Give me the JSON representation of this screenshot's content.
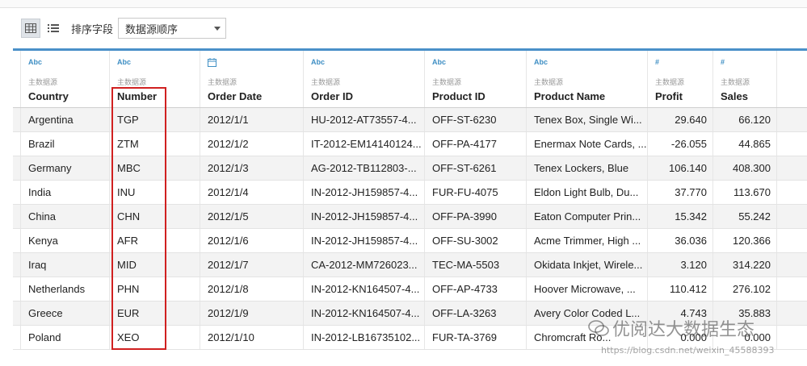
{
  "toolbar": {
    "sort_label": "排序字段",
    "sort_value": "数据源顺序"
  },
  "columns": [
    {
      "type": "Abc",
      "source": "主数据源",
      "name": "Country"
    },
    {
      "type": "Abc",
      "source": "主数据源",
      "name": "Number"
    },
    {
      "type": "date",
      "source": "主数据源",
      "name": "Order Date"
    },
    {
      "type": "Abc",
      "source": "主数据源",
      "name": "Order ID"
    },
    {
      "type": "Abc",
      "source": "主数据源",
      "name": "Product ID"
    },
    {
      "type": "Abc",
      "source": "主数据源",
      "name": "Product Name"
    },
    {
      "type": "#",
      "source": "主数据源",
      "name": "Profit"
    },
    {
      "type": "#",
      "source": "主数据源",
      "name": "Sales"
    }
  ],
  "rows": [
    [
      "Argentina",
      "TGP",
      "2012/1/1",
      "HU-2012-AT73557-4...",
      "OFF-ST-6230",
      "Tenex Box, Single Wi...",
      "29.640",
      "66.120"
    ],
    [
      "Brazil",
      "ZTM",
      "2012/1/2",
      "IT-2012-EM14140124...",
      "OFF-PA-4177",
      "Enermax Note Cards, ...",
      "-26.055",
      "44.865"
    ],
    [
      "Germany",
      "MBC",
      "2012/1/3",
      "AG-2012-TB112803-...",
      "OFF-ST-6261",
      "Tenex Lockers, Blue",
      "106.140",
      "408.300"
    ],
    [
      "India",
      "INU",
      "2012/1/4",
      "IN-2012-JH159857-4...",
      "FUR-FU-4075",
      "Eldon Light Bulb, Du...",
      "37.770",
      "113.670"
    ],
    [
      "China",
      "CHN",
      "2012/1/5",
      "IN-2012-JH159857-4...",
      "OFF-PA-3990",
      "Eaton Computer Prin...",
      "15.342",
      "55.242"
    ],
    [
      "Kenya",
      "AFR",
      "2012/1/6",
      "IN-2012-JH159857-4...",
      "OFF-SU-3002",
      "Acme Trimmer, High ...",
      "36.036",
      "120.366"
    ],
    [
      "Iraq",
      "MID",
      "2012/1/7",
      "CA-2012-MM726023...",
      "TEC-MA-5503",
      "Okidata Inkjet, Wirele...",
      "3.120",
      "314.220"
    ],
    [
      "Netherlands",
      "PHN",
      "2012/1/8",
      "IN-2012-KN164507-4...",
      "OFF-AP-4733",
      "Hoover Microwave, ...",
      "110.412",
      "276.102"
    ],
    [
      "Greece",
      "EUR",
      "2012/1/9",
      "IN-2012-KN164507-4...",
      "OFF-LA-3263",
      "Avery Color Coded L...",
      "4.743",
      "35.883"
    ],
    [
      "Poland",
      "XEO",
      "2012/1/10",
      "IN-2012-LB16735102...",
      "FUR-TA-3769",
      "Chromcraft Ro...",
      "0.000",
      "0.000"
    ]
  ],
  "watermark": {
    "text": "优阅达大数据生态",
    "url": "https://blog.csdn.net/weixin_45588393"
  },
  "colors": {
    "header_accent": "#4a90c8",
    "highlight_box": "#d02020",
    "type_icon": "#3f8fc4"
  }
}
